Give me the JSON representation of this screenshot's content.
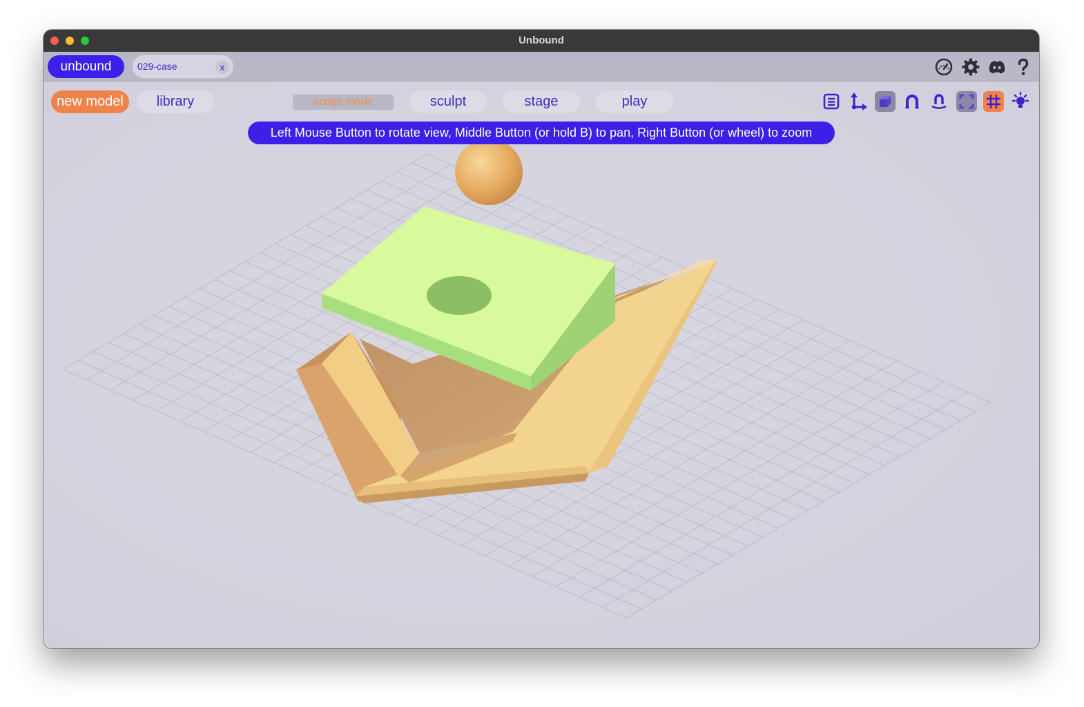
{
  "window": {
    "title": "Unbound"
  },
  "tabs": {
    "app_label": "unbound",
    "file_tab": {
      "label": "029-case",
      "close_label": "x"
    }
  },
  "top_right_icons": [
    "performance-gauge-icon",
    "settings-gear-icon",
    "discord-icon",
    "help-icon"
  ],
  "toolbar": {
    "new_model_label": "new model",
    "library_label": "library",
    "mode_label": "sculpt mode",
    "mode_tabs": [
      "sculpt",
      "stage",
      "play"
    ]
  },
  "hint": "Left Mouse Button to rotate view, Middle Button (or hold B) to pan, Right Button (or wheel) to zoom",
  "tool_icons": [
    {
      "name": "list-icon",
      "active": false
    },
    {
      "name": "axis-gizmo-icon",
      "active": false
    },
    {
      "name": "cube-view-icon",
      "active": true
    },
    {
      "name": "magnet-icon",
      "active": false
    },
    {
      "name": "snap-magnet-icon",
      "active": false
    },
    {
      "name": "frame-focus-icon",
      "active": true
    },
    {
      "name": "grid-icon",
      "active": true
    },
    {
      "name": "light-bulb-icon",
      "active": false
    }
  ],
  "colors": {
    "accent": "#3d20e8",
    "orange": "#f0834a",
    "viewport_bg": "#d3d2dd",
    "green_box": "#d9f99d",
    "orange_shape": "#f3d48f"
  }
}
